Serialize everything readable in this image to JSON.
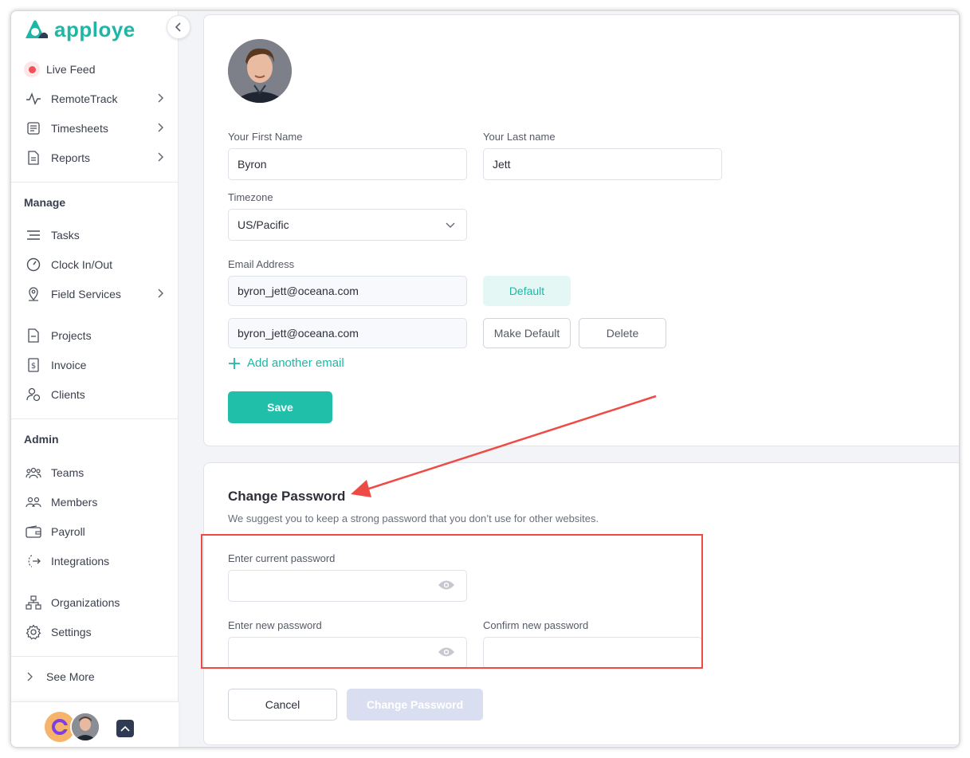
{
  "brand": {
    "name": "apploye",
    "accent": "#1eb7a6"
  },
  "sidebar": {
    "collapse_icon": "chevron-left-icon",
    "top_items": [
      {
        "label": "Live Feed",
        "icon": "live-dot-icon"
      },
      {
        "label": "RemoteTrack",
        "icon": "pulse-icon",
        "has_submenu": true
      },
      {
        "label": "Timesheets",
        "icon": "timesheet-icon",
        "has_submenu": true
      },
      {
        "label": "Reports",
        "icon": "report-icon",
        "has_submenu": true
      }
    ],
    "manage": {
      "title": "Manage",
      "items": [
        {
          "label": "Tasks",
          "icon": "tasks-icon"
        },
        {
          "label": "Clock In/Out",
          "icon": "clock-icon"
        },
        {
          "label": "Field Services",
          "icon": "location-pin-icon",
          "has_submenu": true
        },
        {
          "label": "Projects",
          "icon": "project-icon"
        },
        {
          "label": "Invoice",
          "icon": "invoice-icon"
        },
        {
          "label": "Clients",
          "icon": "client-icon"
        }
      ]
    },
    "admin": {
      "title": "Admin",
      "items": [
        {
          "label": "Teams",
          "icon": "teams-icon"
        },
        {
          "label": "Members",
          "icon": "members-icon"
        },
        {
          "label": "Payroll",
          "icon": "wallet-icon"
        },
        {
          "label": "Integrations",
          "icon": "integrations-icon"
        },
        {
          "label": "Organizations",
          "icon": "org-chart-icon"
        },
        {
          "label": "Settings",
          "icon": "gear-icon"
        }
      ]
    },
    "see_more": "See More"
  },
  "profile": {
    "first_name_label": "Your First Name",
    "first_name": "Byron",
    "last_name_label": "Your Last name",
    "last_name": "Jett",
    "timezone_label": "Timezone",
    "timezone": "US/Pacific",
    "email_label": "Email Address",
    "emails": [
      {
        "address": "byron_jett@oceana.com",
        "action": "Default"
      },
      {
        "address": "byron_jett@oceana.com",
        "make_default": "Make Default",
        "delete": "Delete"
      }
    ],
    "add_email": "Add another email",
    "save": "Save"
  },
  "change_password": {
    "title": "Change Password",
    "subtitle": "We suggest you to keep a strong password that you don’t use for other websites.",
    "current_label": "Enter current password",
    "new_label": "Enter new password",
    "confirm_label": "Confirm new password",
    "cancel": "Cancel",
    "submit": "Change Password"
  },
  "annotation": {
    "color": "#ef4b46"
  }
}
